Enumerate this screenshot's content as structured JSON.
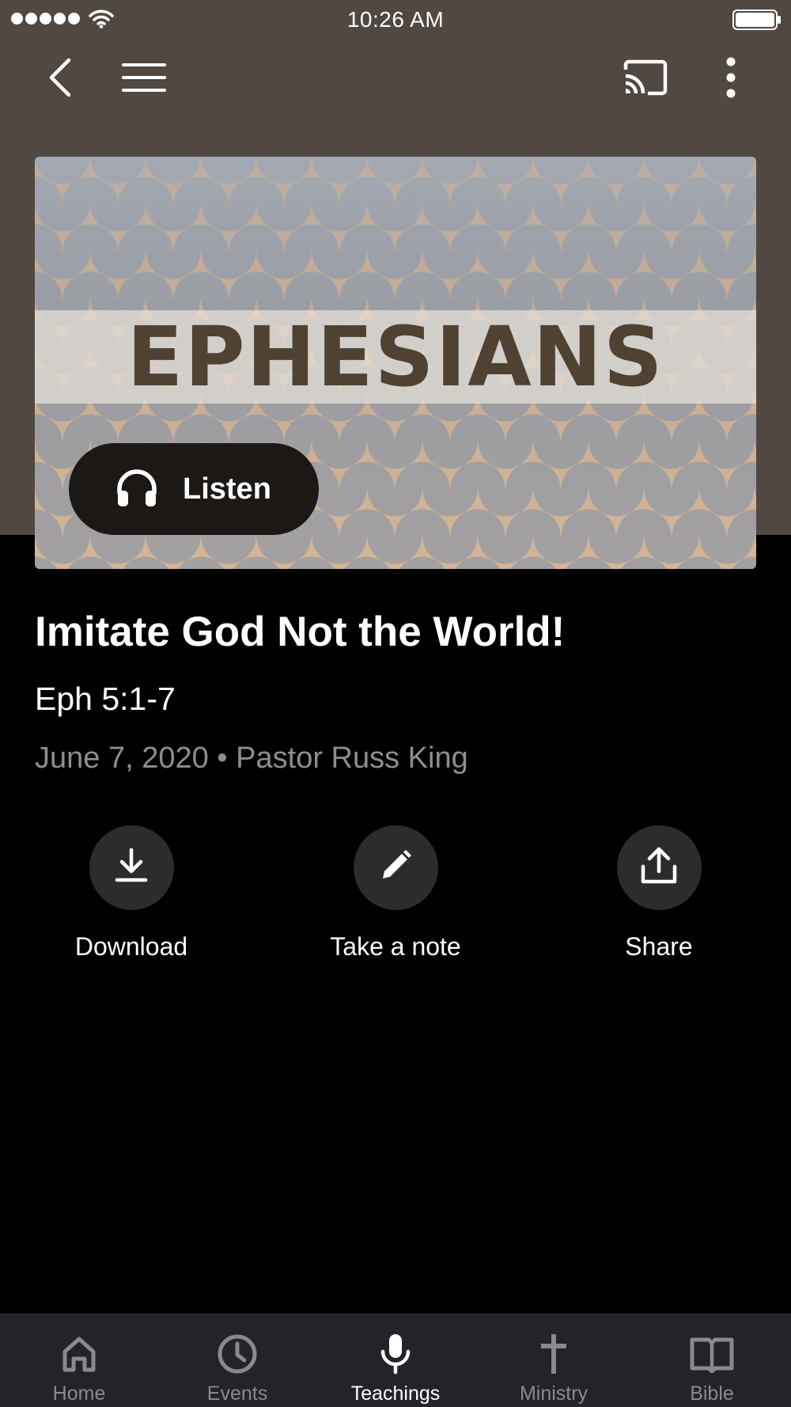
{
  "status_bar": {
    "time": "10:26 AM"
  },
  "nav": {
    "icons": [
      "back-icon",
      "hamburger-menu-icon",
      "cast-icon",
      "more-vertical-icon"
    ]
  },
  "artwork": {
    "series_title": "EPHESIANS"
  },
  "listen_button": {
    "label": "Listen",
    "icon": "headphones-icon"
  },
  "sermon": {
    "title": "Imitate God Not the World!",
    "scripture": "Eph 5:1-7",
    "meta": "June 7, 2020 • Pastor Russ King"
  },
  "actions": [
    {
      "label": "Download",
      "icon": "download-icon"
    },
    {
      "label": "Take a note",
      "icon": "pencil-icon"
    },
    {
      "label": "Share",
      "icon": "share-icon"
    }
  ],
  "tab_bar": {
    "active": "Teachings",
    "tabs": [
      {
        "label": "Home",
        "icon": "home-icon"
      },
      {
        "label": "Events",
        "icon": "clock-icon"
      },
      {
        "label": "Teachings",
        "icon": "microphone-icon"
      },
      {
        "label": "Ministry",
        "icon": "cross-icon"
      },
      {
        "label": "Bible",
        "icon": "book-icon"
      }
    ]
  },
  "colors": {
    "header_background": "#514841",
    "page_background": "#000000",
    "tab_bar_background": "#242428",
    "action_circle": "#2c2c2c",
    "meta_text": "#8e8e8e",
    "tab_inactive": "#8a8a8e",
    "art_title": "#4f4232"
  }
}
